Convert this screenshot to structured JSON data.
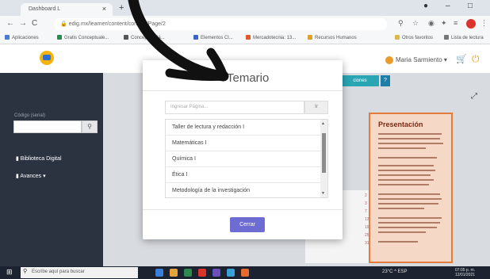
{
  "browser": {
    "tab_title": "Dashboard L",
    "tab_close": "×",
    "new_tab": "+",
    "url": "edig.mx/learner/content/content/Page/2",
    "window_controls": [
      "minimize-icon",
      "maximize-icon",
      "close-icon"
    ],
    "bookmarks": [
      {
        "label": "Aplicaciones",
        "color": "#4a7bd4"
      },
      {
        "label": "Gratis Conceptuale...",
        "color": "#2d8a4e"
      },
      {
        "label": "Conceptos Bá...",
        "color": "#555555"
      },
      {
        "label": "Elementos Cl...",
        "color": "#3a64c8"
      },
      {
        "label": "Mercadotecnia: 13...",
        "color": "#e3572e"
      },
      {
        "label": "Recursos Humanos",
        "color": "#e0a12a"
      },
      {
        "label": "Otros favoritos",
        "color": "#e0b84a"
      },
      {
        "label": "Lista de lectura",
        "color": "#777777"
      }
    ]
  },
  "app": {
    "user_name": "Maria Sarmiento ▾",
    "sidebar": {
      "items": [
        {
          "label": "Biblioteca Digital"
        },
        {
          "label": "Avances ▾"
        }
      ],
      "code_label": "Código (serial)",
      "search_icon": "search-icon"
    },
    "content": {
      "teal_button": "ciones",
      "help_button": "?",
      "doc_title": "Presentación",
      "side_numbers": [
        "2",
        "3",
        "7",
        "13",
        "19",
        "25",
        "31"
      ]
    }
  },
  "modal": {
    "title": "Temario",
    "search_placeholder": "Ingresar Página...",
    "search_button": "Ir",
    "items": [
      {
        "label": "Taller de lectura y redacción I"
      },
      {
        "label": "Matemáticas I"
      },
      {
        "label": "Química I"
      },
      {
        "label": "Ética I"
      },
      {
        "label": "Metodología de la investigación"
      }
    ],
    "close_button": "Cerrar"
  },
  "taskbar": {
    "search_placeholder": "Escribe aquí para buscar",
    "tray_text": "23°C  ^  ESP",
    "time": "07:05 p. m.",
    "date": "12/01/2021",
    "app_colors": [
      "#3b7dd8",
      "#e4a23a",
      "#2d8a4e",
      "#d9352c",
      "#6b4fbb",
      "#3aa0d8",
      "#e66b2e"
    ]
  },
  "colors": {
    "sidebar": "#2b3240",
    "accent_orange": "#e9a31a",
    "modal_button": "#6c6cd3",
    "teal": "#2aa5b4"
  }
}
